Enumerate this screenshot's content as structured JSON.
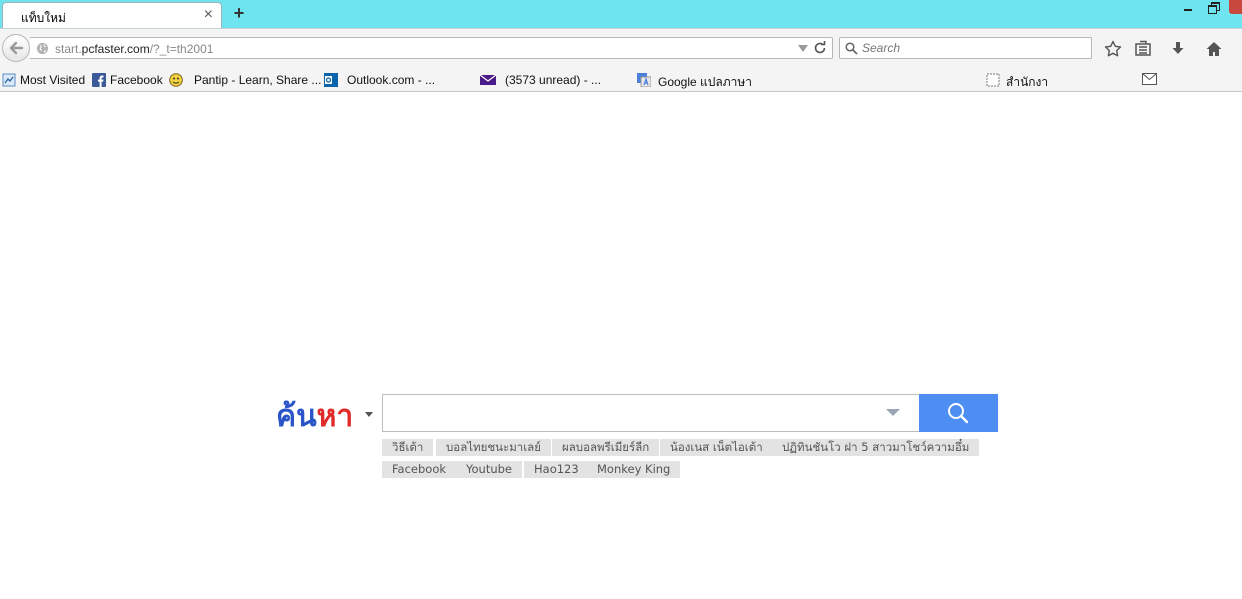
{
  "browser": {
    "tab_title": "แท็บใหม่",
    "tab_close": "×",
    "new_tab": "+",
    "url_prefix": "start.",
    "url_host": "pcfaster.com",
    "url_path": "/?_t=th2001",
    "search_placeholder": "Search"
  },
  "bookmarks": [
    {
      "label": "Most Visited",
      "icon": "most-visited-icon"
    },
    {
      "label": "Facebook",
      "icon": "facebook-icon"
    },
    {
      "label": "Pantip - Learn, Share ...",
      "icon": "pantip-icon"
    },
    {
      "label": "Outlook.com - ...",
      "icon": "outlook-icon"
    },
    {
      "label": "(3573 unread) - ...",
      "icon": "mail-icon"
    },
    {
      "label": "Google แปลภาษา",
      "icon": "translate-icon"
    },
    {
      "label": "สำนักงา",
      "icon": "page-icon"
    }
  ],
  "search": {
    "logo_part1": "ค้น",
    "logo_part2": "หา",
    "query": "",
    "suggestions": [
      "วิธีเต้า",
      "บอลไทยชนะมาเลย์",
      "ผลบอลพรีเมียร์ลีก",
      "น้องเนส เน็ตไอเต้า",
      "ปฏิทินชันโว ฝา 5 สาวมาโชว์ความอึ๋ม",
      "Facebook",
      "Youtube",
      "Hao123",
      "Monkey King"
    ]
  },
  "colors": {
    "titlebar": "#6ee4ee",
    "logo_blue": "#2a55c8",
    "logo_red": "#e02a2a",
    "search_button": "#4d8ef3"
  }
}
